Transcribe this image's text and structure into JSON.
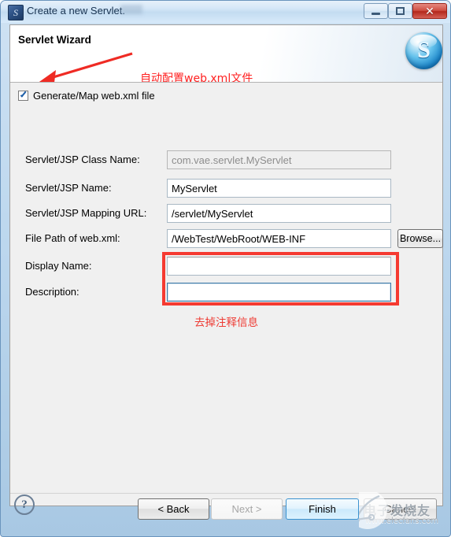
{
  "window": {
    "title": "Create a new Servlet.",
    "icon": "servlet-app-icon",
    "minimize_label": "Minimize",
    "maximize_label": "Maximize",
    "close_label": "✕"
  },
  "wizard": {
    "header_title": "Servlet Wizard",
    "logo": "blue-s-sphere-logo",
    "checkbox": {
      "label": "Generate/Map web.xml file",
      "checked": true
    },
    "fields": [
      {
        "label": "Servlet/JSP Class Name:",
        "value": "com.vae.servlet.MyServlet",
        "placeholder": "",
        "state": "readonly",
        "name": "servlet-class-name"
      },
      {
        "label": "Servlet/JSP Name:",
        "value": "MyServlet",
        "placeholder": "",
        "state": "normal",
        "name": "servlet-name"
      },
      {
        "label": "Servlet/JSP Mapping URL:",
        "value": "/servlet/MyServlet",
        "placeholder": "",
        "state": "normal",
        "name": "servlet-mapping-url"
      },
      {
        "label": "File Path of web.xml:",
        "value": "/WebTest/WebRoot/WEB-INF",
        "placeholder": "",
        "state": "normal",
        "name": "webxml-file-path"
      },
      {
        "label": "Display Name:",
        "value": "",
        "placeholder": "",
        "state": "normal",
        "name": "display-name"
      },
      {
        "label": "Description:",
        "value": "",
        "placeholder": "",
        "state": "focused",
        "name": "description"
      }
    ],
    "browse_label": "Browse..."
  },
  "annotations": {
    "arrow_text": "自动配置web.xml文件",
    "box_text": "去掉注释信息",
    "color": "#f53a31"
  },
  "footer": {
    "help_label": "?",
    "back_label": "< Back",
    "next_label": "Next >",
    "finish_label": "Finish",
    "cancel_label": "Cancel"
  },
  "watermark": {
    "cn": "电子发烧友",
    "url": "www.elecfans.com"
  }
}
